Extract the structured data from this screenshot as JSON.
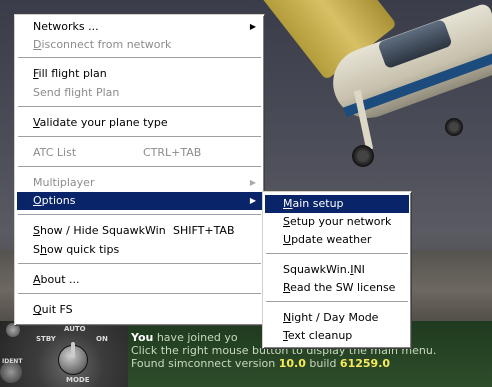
{
  "main_menu": {
    "items": [
      {
        "label": "Networks ...",
        "mn": "",
        "rest": "",
        "shortcut": "",
        "submenu": true,
        "disabled": false
      },
      {
        "label": "Disconnect from network",
        "mn": "D",
        "rest": "isconnect from network",
        "shortcut": "",
        "submenu": false,
        "disabled": true
      },
      {
        "label": "Fill flight plan",
        "mn": "F",
        "rest": "ill flight plan",
        "shortcut": "",
        "submenu": false,
        "disabled": false
      },
      {
        "label": "Send flight Plan",
        "mn": "",
        "rest": "",
        "shortcut": "",
        "submenu": false,
        "disabled": true
      },
      {
        "label": "Validate your plane type",
        "mn": "V",
        "rest": "alidate your plane type",
        "shortcut": "",
        "submenu": false,
        "disabled": false
      },
      {
        "label": "ATC List",
        "mn": "",
        "rest": "",
        "shortcut": "CTRL+TAB",
        "submenu": false,
        "disabled": true
      },
      {
        "label": "Multiplayer",
        "mn": "",
        "rest": "",
        "shortcut": "",
        "submenu": true,
        "disabled": true
      },
      {
        "label": "Options",
        "mn": "O",
        "rest": "ptions",
        "shortcut": "",
        "submenu": true,
        "disabled": false,
        "selected": true
      },
      {
        "label": "Show / Hide SquawkWin",
        "mn": "S",
        "rest": "how / Hide SquawkWin",
        "shortcut": "SHIFT+TAB",
        "submenu": false,
        "disabled": false
      },
      {
        "label": "Show quick tips",
        "pre": "S",
        "mn": "h",
        "rest": "ow quick tips",
        "shortcut": "",
        "submenu": false,
        "disabled": false
      },
      {
        "label": "About ...",
        "mn": "A",
        "rest": "bout ...",
        "shortcut": "",
        "submenu": false,
        "disabled": false
      },
      {
        "label": "Quit FS",
        "mn": "Q",
        "rest": "uit FS",
        "shortcut": "",
        "submenu": false,
        "disabled": false
      }
    ]
  },
  "options_submenu": {
    "items": [
      {
        "label": "Main setup",
        "pre": "",
        "mn": "M",
        "rest": "ain setup",
        "selected": true
      },
      {
        "label": "Setup your network",
        "pre": "",
        "mn": "S",
        "rest": "etup your network"
      },
      {
        "label": "Update weather",
        "pre": "",
        "mn": "U",
        "rest": "pdate weather"
      },
      {
        "label": "SquawkWin.INI",
        "pre": "SquawkWin.",
        "mn": "I",
        "rest": "NI"
      },
      {
        "label": "Read the SW license",
        "pre": "",
        "mn": "R",
        "rest": "ead the SW license"
      },
      {
        "label": "Night / Day Mode",
        "pre": "",
        "mn": "N",
        "rest": "ight / Day Mode"
      },
      {
        "label": "Text cleanup",
        "pre": "",
        "mn": "T",
        "rest": "ext cleanup"
      }
    ]
  },
  "radio_panel": {
    "labels": {
      "stby": "STBY",
      "auto": "AUTO",
      "on": "ON",
      "mode": "MODE",
      "ident": "IDENT"
    }
  },
  "status": {
    "line1_you": "You",
    "line1_rest": " have joined yo",
    "line2": "Click the right mouse button to display the main menu.",
    "line3_pre": "Found simconnect version ",
    "version": "10.0",
    "line3_mid": " build ",
    "build": "61259.0"
  },
  "colors": {
    "highlight": "#0a246a",
    "status_number": "#f6e95b"
  }
}
